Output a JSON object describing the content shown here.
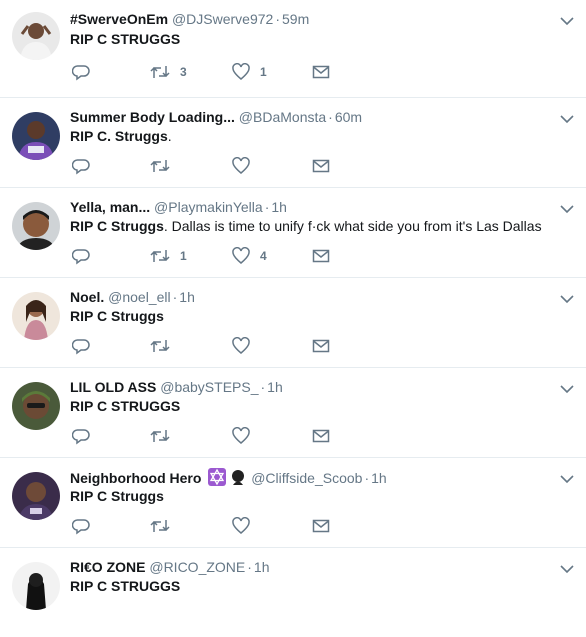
{
  "tweets": [
    {
      "name": "#SwerveOnEm",
      "handle": "@DJSwerve972",
      "time": "59m",
      "text_bold": "RIP C STRUGGS",
      "text_rest": "",
      "retweets": "3",
      "likes": "1"
    },
    {
      "name": "Summer Body Loading...",
      "handle": "@BDaMonsta",
      "time": "60m",
      "text_bold": "RIP C. Struggs",
      "text_rest": ".",
      "retweets": "",
      "likes": ""
    },
    {
      "name": "Yella, man...",
      "handle": "@PlaymakinYella",
      "time": "1h",
      "text_bold": "RIP C Struggs",
      "text_rest": ". Dallas is time to unify f·ck what side you from it's Las Dallas",
      "retweets": "1",
      "likes": "4"
    },
    {
      "name": "Noel.",
      "handle": "@noel_ell",
      "time": "1h",
      "text_bold": "RIP C Struggs",
      "text_rest": "",
      "retweets": "",
      "likes": ""
    },
    {
      "name": "LIL OLD ASS",
      "handle": "@babySTEPS_",
      "time": "1h",
      "text_bold": "RIP C STRUGGS",
      "text_rest": "",
      "retweets": "",
      "likes": ""
    },
    {
      "name": "Neighborhood Hero",
      "handle": "@Cliffside_Scoob",
      "time": "1h",
      "text_bold": "RIP C Struggs",
      "text_rest": "",
      "retweets": "",
      "likes": ""
    },
    {
      "name": "RI€O ZONE",
      "handle": "@RICO_ZONE",
      "time": "1h",
      "text_bold": "RIP C STRUGGS",
      "text_rest": "",
      "retweets": "",
      "likes": ""
    }
  ],
  "separator": "·",
  "icons": {
    "reply": "reply-icon",
    "retweet": "retweet-icon",
    "like": "heart-icon",
    "dm": "envelope-icon",
    "caret": "chevron-down-icon"
  },
  "colors": {
    "text": "#14171a",
    "muted": "#657786",
    "border": "#e6ecf0"
  }
}
